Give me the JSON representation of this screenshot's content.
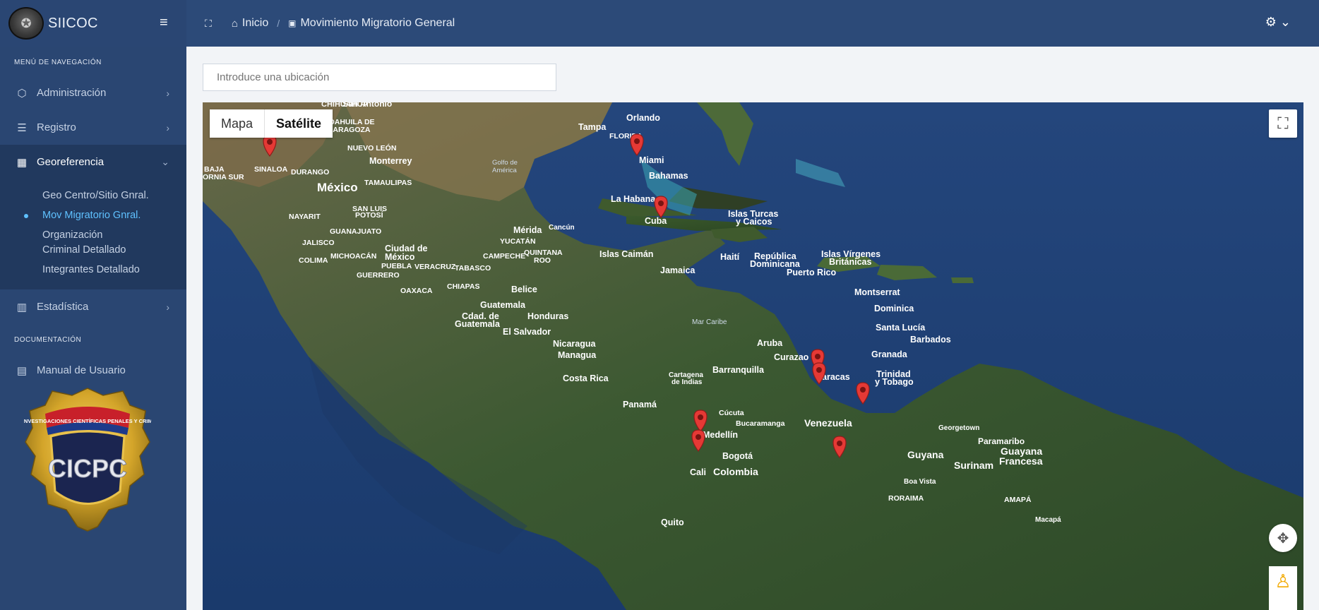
{
  "app": {
    "name": "SIICOC"
  },
  "icons": {
    "hamburger": "≡",
    "fullscreen": "⛶",
    "home": "⌂",
    "doc": "▣",
    "gear": "⚙ ⌄"
  },
  "breadcrumb": {
    "home": "Inicio",
    "separator": "/",
    "current": "Movimiento Migratorio General"
  },
  "sidebar": {
    "nav_header": "MENÚ DE NAVEGACIÓN",
    "items": [
      {
        "label": "Administración",
        "icon": "cube-icon"
      },
      {
        "label": "Registro",
        "icon": "list-icon"
      },
      {
        "label": "Georeferencia",
        "icon": "map-icon"
      }
    ],
    "submenu": [
      "Geo Centro/Sitio Gnral.",
      "Mov Migratorio Gnral.",
      "Organización Criminal Detallado",
      "Integrantes Detallado"
    ],
    "stats": "Estadística",
    "doc_header": "DOCUMENTACIÓN",
    "manual": "Manual de Usuario",
    "badge_text": "CUERPO DE INVESTIGACIONES CIENTÍFICAS PENALES Y CRIMINALÍSTICAS",
    "badge_letters": "CICPC"
  },
  "search": {
    "placeholder": "Introduce una ubicación"
  },
  "map": {
    "type_map": "Mapa",
    "type_satellite": "Satélite",
    "active_type": "Satélite",
    "labels": {
      "san_antonio": "San Antonio",
      "chihuahua": "CHIHUAHUA",
      "coahuila": "COAHUILA DE",
      "zaragoza": "ZARAGOZA",
      "nuevo_leon": "NUEVO LEÓN",
      "monterrey": "Monterrey",
      "sinaloa": "SINALOA",
      "durango": "DURANGO",
      "baja": "BAJA",
      "ornia_sur": "ORNIA SUR",
      "mexico": "México",
      "tamaulipas": "TAMAULIPAS",
      "nayarit": "NAYARIT",
      "san_luis": "SAN LUIS",
      "potosi": "POTOSÍ",
      "guanajuato": "GUANAJUATO",
      "jalisco": "JALISCO",
      "michoacan": "MICHOACÁN",
      "colima": "COLIMA",
      "ciudad_de": "Ciudad de",
      "mexico_city": "México",
      "puebla": "PUEBLA",
      "veracruz": "VERACRUZ",
      "tabasco": "TABASCO",
      "guerrero": "GUERRERO",
      "oaxaca": "OAXACA",
      "chiapas": "CHIAPAS",
      "golfo": "Golfo de",
      "america": "América",
      "merida": "Mérida",
      "cancun": "Cancún",
      "yucatan": "YUCATÁN",
      "campeche": "CAMPECHE",
      "quintana": "QUINTANA",
      "roo": "ROO",
      "belice": "Belice",
      "guatemala": "Guatemala",
      "cdad": "Cdad. de",
      "guatemala2": "Guatemala",
      "honduras": "Honduras",
      "el_salvador": "El Salvador",
      "nicaragua": "Nicaragua",
      "managua": "Managua",
      "costa_rica": "Costa Rica",
      "panama": "Panamá",
      "orlando": "Orlando",
      "tampa": "Tampa",
      "florida": "FLORIDA",
      "miami": "Miami",
      "bahamas": "Bahamas",
      "la_habana": "La Habana",
      "cuba": "Cuba",
      "islas_turcas": "Islas Turcas",
      "y_caicos": "y Caicos",
      "islas_caiman": "Islas Caimán",
      "jamaica": "Jamaica",
      "haiti": "Haití",
      "rep_dom": "República",
      "dominicana": "Dominicana",
      "puerto_rico": "Puerto Rico",
      "islas_virgenes": "Islas Vírgenes",
      "britanicas": "Británicas",
      "montserrat": "Montserrat",
      "dominica": "Dominica",
      "santa_lucia": "Santa Lucía",
      "barbados": "Barbados",
      "mar_caribe": "Mar Caribe",
      "aruba": "Aruba",
      "curazao": "Curazao",
      "granada": "Granada",
      "trinidad": "Trinidad",
      "y_tobago": "y Tobago",
      "cartagena": "Cartagena",
      "de_indias": "de Indias",
      "barranquilla": "Barranquilla",
      "caracas": "Caracas",
      "cucuta": "Cúcuta",
      "bucaramanga": "Bucaramanga",
      "venezuela": "Venezuela",
      "georgetown": "Georgetown",
      "medellin": "Medellín",
      "bogota": "Bogotá",
      "colombia": "Colombia",
      "cali": "Cali",
      "paramaribo": "Paramaribo",
      "guyana": "Guyana",
      "guayana": "Guayana",
      "francesa": "Francesa",
      "surinam": "Surinam",
      "boa_vista": "Boa Vista",
      "roraima": "RORAIMA",
      "amapa": "AMAPÁ",
      "macapa": "Macapá",
      "quito": "Quito"
    },
    "markers": [
      {
        "name": "Sinaloa"
      },
      {
        "name": "Miami"
      },
      {
        "name": "Cuba"
      },
      {
        "name": "Caracas norte"
      },
      {
        "name": "Caracas"
      },
      {
        "name": "Trinidad"
      },
      {
        "name": "Medellín norte"
      },
      {
        "name": "Medellín"
      },
      {
        "name": "Venezuela sur"
      }
    ]
  }
}
